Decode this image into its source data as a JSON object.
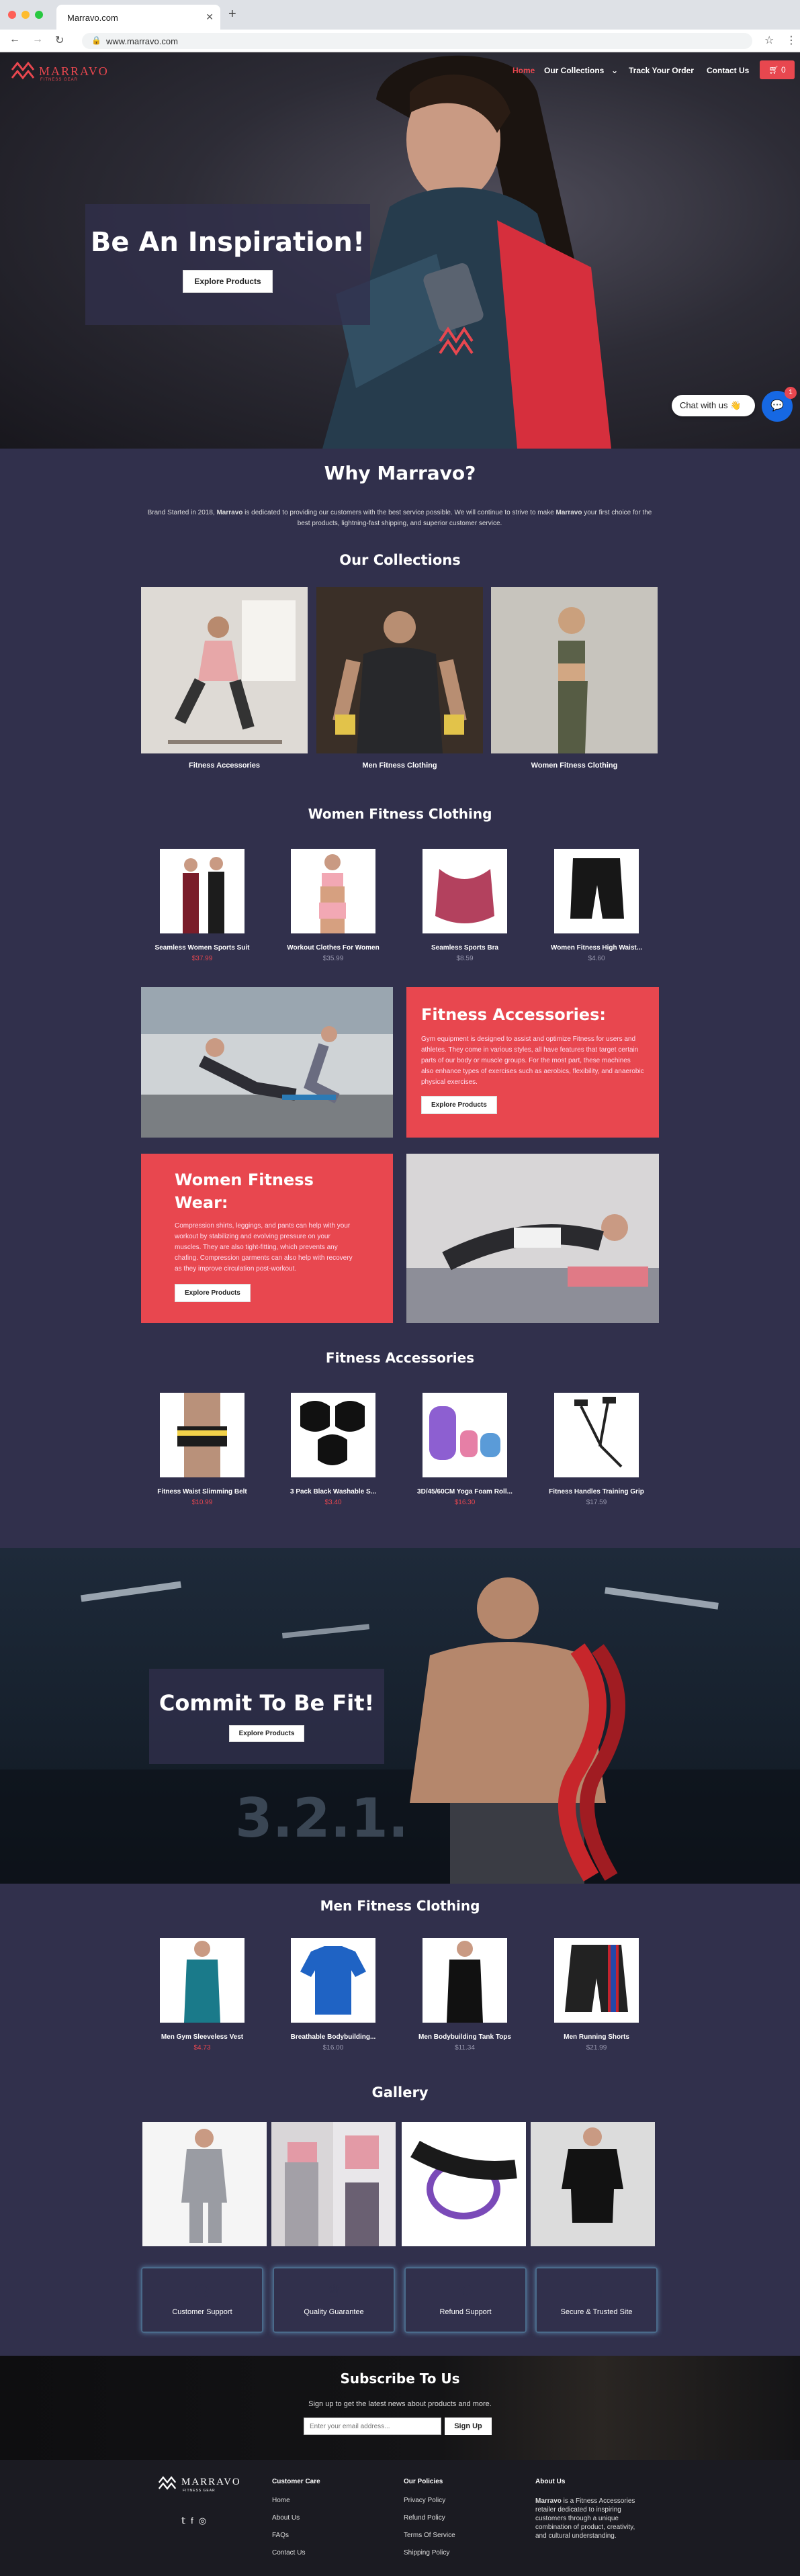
{
  "browser": {
    "tab_title": "Marravo.com",
    "url": "www.marravo.com"
  },
  "nav": {
    "logo": "MARRAVO",
    "logo_sub": "FITNESS GEAR",
    "links": [
      "Home",
      "Our Collections",
      "Track Your Order",
      "Contact Us"
    ],
    "cart_count": "0"
  },
  "hero": {
    "title": "Be An Inspiration!",
    "button": "Explore Products"
  },
  "chat": {
    "label": "Chat with us 👋",
    "badge": "1"
  },
  "why": {
    "title": "Why Marravo?",
    "text_before": "Brand Started in 2018, ",
    "brand": "Marravo",
    "text_mid": " is dedicated to providing our customers with the best service possible. We will continue to strive to make ",
    "brand2": "Marravo",
    "text_after": " your first choice for the best products, lightning-fast shipping, and superior customer service."
  },
  "collections": {
    "title": "Our Collections",
    "items": [
      "Fitness Accessories",
      "Men Fitness Clothing",
      "Women Fitness Clothing"
    ]
  },
  "women": {
    "title": "Women Fitness Clothing",
    "products": [
      {
        "name": "Seamless Women Sports Suit",
        "price": "$37.99",
        "sale": true
      },
      {
        "name": "Workout Clothes For Women",
        "price": "$35.99",
        "sale": false
      },
      {
        "name": "Seamless Sports Bra",
        "price": "$8.59",
        "sale": false
      },
      {
        "name": "Women Fitness High Waist...",
        "price": "$4.60",
        "sale": false
      }
    ]
  },
  "promo_accessories": {
    "title": "Fitness Accessories:",
    "text": "Gym equipment is designed to assist and optimize Fitness for users and athletes. They come in various styles, all have features that target certain parts of our body or muscle groups. For the most part, these machines also enhance types of exercises such as aerobics, flexibility, and anaerobic physical exercises.",
    "button": "Explore Products"
  },
  "promo_women": {
    "title": "Women Fitness Wear:",
    "text": "Compression shirts, leggings, and pants can help with your workout by stabilizing and evolving pressure on your muscles. They are also tight-fitting, which prevents any chafing. Compression garments can also help with recovery as they improve circulation post-workout.",
    "button": "Explore Products"
  },
  "accessories": {
    "title": "Fitness Accessories",
    "products": [
      {
        "name": "Fitness Waist Slimming Belt",
        "price": "$10.99",
        "sale": true
      },
      {
        "name": "3 Pack Black Washable S...",
        "price": "$3.40",
        "sale": true
      },
      {
        "name": "3D/45/60CM Yoga Foam Roll...",
        "price": "$16.30",
        "sale": true
      },
      {
        "name": "Fitness Handles Training Grip",
        "price": "$17.59",
        "sale": false
      }
    ]
  },
  "hero2": {
    "title": "Commit To Be Fit!",
    "button": "Explore Products",
    "floor_text": "3.2.1."
  },
  "men": {
    "title": "Men Fitness Clothing",
    "products": [
      {
        "name": "Men Gym Sleeveless Vest",
        "price": "$4.73",
        "sale": true
      },
      {
        "name": "Breathable Bodybuilding...",
        "price": "$16.00",
        "sale": false
      },
      {
        "name": "Men Bodybuilding Tank Tops",
        "price": "$11.34",
        "sale": false
      },
      {
        "name": "Men Running Shorts",
        "price": "$21.99",
        "sale": false
      }
    ]
  },
  "gallery": {
    "title": "Gallery"
  },
  "features": [
    {
      "label": "Customer Support",
      "icon": "headset-icon"
    },
    {
      "label": "Quality Guarantee",
      "icon": "medal-icon"
    },
    {
      "label": "Refund Support",
      "icon": "refund-icon"
    },
    {
      "label": "Secure & Trusted Site",
      "icon": "lock-icon"
    }
  ],
  "subscribe": {
    "title": "Subscribe To Us",
    "text": "Sign up to get the latest news about products and more.",
    "placeholder": "Enter your email address...",
    "button": "Sign Up"
  },
  "footer": {
    "logo": "MARRAVO",
    "logo_sub": "FITNESS GEAR",
    "care_title": "Customer Care",
    "care": [
      "Home",
      "About Us",
      "FAQs",
      "Contact Us"
    ],
    "policy_title": "Our Policies",
    "policies": [
      "Privacy Policy",
      "Refund Policy",
      "Terms Of Service",
      "Shipping Policy"
    ],
    "about_title": "About Us",
    "about_brand": "Marravo",
    "about_text": " is a Fitness Accessories retailer dedicated to inspiring customers through a unique combination of product, creativity, and cultural understanding."
  },
  "colors": {
    "accent": "#e8474f",
    "bg": "#31304c",
    "footer": "#1b1b22"
  }
}
